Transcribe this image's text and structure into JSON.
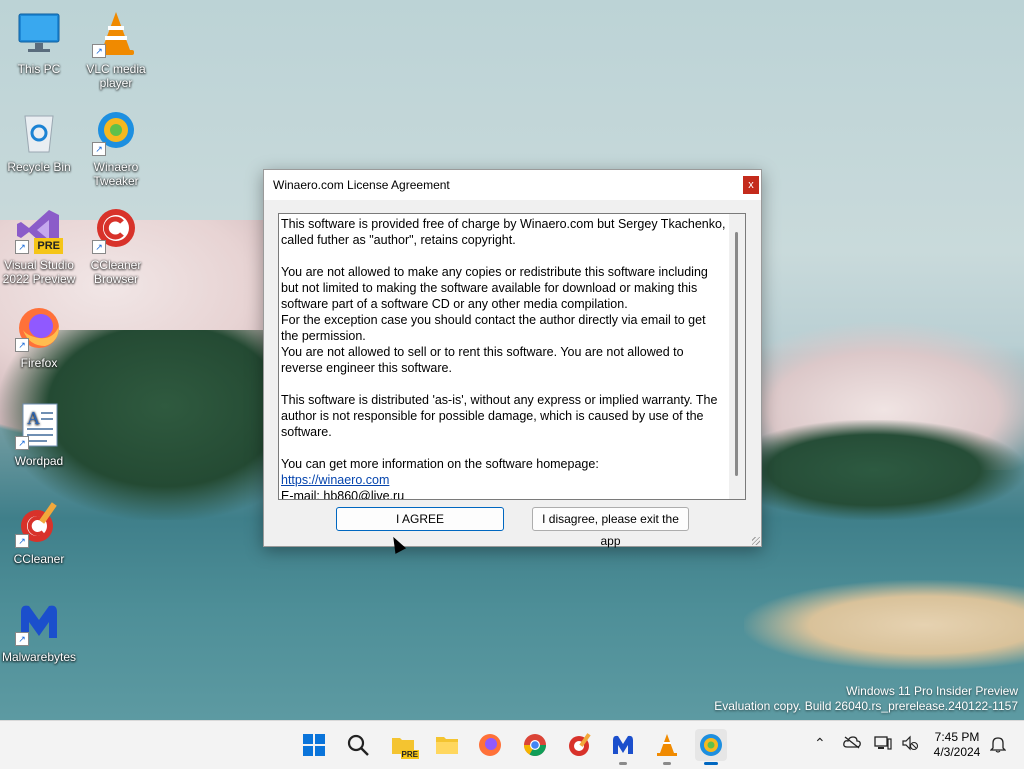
{
  "desktop": {
    "icons": [
      {
        "label": "This PC",
        "icon": "this-pc-icon"
      },
      {
        "label": "VLC media player",
        "icon": "vlc-icon"
      },
      {
        "label": "Recycle Bin",
        "icon": "recycle-bin-icon"
      },
      {
        "label": "Winaero Tweaker",
        "icon": "winaero-tweaker-icon"
      },
      {
        "label": "Visual Studio 2022 Preview",
        "icon": "visual-studio-icon"
      },
      {
        "label": "CCleaner Browser",
        "icon": "ccleaner-browser-icon"
      },
      {
        "label": "Firefox",
        "icon": "firefox-icon"
      },
      {
        "label": "Wordpad",
        "icon": "wordpad-icon"
      },
      {
        "label": "CCleaner",
        "icon": "ccleaner-icon"
      },
      {
        "label": "Malwarebytes",
        "icon": "malwarebytes-icon"
      }
    ],
    "vs_badge": "PRE",
    "watermark": {
      "line1": "Windows 11 Pro Insider Preview",
      "line2": "Evaluation copy. Build 26040.rs_prerelease.240122-1157"
    }
  },
  "dialog": {
    "title": "Winaero.com License Agreement",
    "close_label": "x",
    "text_paragraphs": [
      "This software is provided free of charge by Winaero.com but Sergey Tkachenko, called futher as \"author\", retains copyright.",
      "You are not allowed to make any copies or redistribute this software including but not limited to making the software available for download or making this software part of a software CD or any other media compilation.\nFor the exception case you should contact the author directly via email to get the permission.\nYou are not allowed to sell or to rent this software. You are not allowed to reverse engineer this software.",
      "This software is distributed 'as-is', without any express or implied warranty. The author is not responsible for possible damage, which is caused by use of the software.",
      "You can get more information on the software homepage:"
    ],
    "homepage_link": "https://winaero.com",
    "email_line": "E-mail: hb860@live.ru",
    "agree_button": "I AGREE",
    "disagree_button": "I disagree, please exit the app"
  },
  "taskbar": {
    "pinned": [
      {
        "name": "start-button",
        "icon": "windows-logo-icon"
      },
      {
        "name": "search-button",
        "icon": "search-icon"
      },
      {
        "name": "taskbar-app-file-explorer-canary",
        "icon": "explorer-pre-icon"
      },
      {
        "name": "taskbar-app-file-explorer",
        "icon": "folder-icon"
      },
      {
        "name": "taskbar-app-firefox",
        "icon": "firefox-icon"
      },
      {
        "name": "taskbar-app-chrome",
        "icon": "chrome-icon"
      },
      {
        "name": "taskbar-app-ccleaner",
        "icon": "ccleaner-icon"
      },
      {
        "name": "taskbar-app-malwarebytes",
        "icon": "malwarebytes-icon"
      },
      {
        "name": "taskbar-app-vlc",
        "icon": "vlc-icon"
      },
      {
        "name": "taskbar-app-winaero-tweaker",
        "icon": "winaero-tweaker-icon"
      }
    ],
    "pre_badge": "PRE",
    "clock": {
      "time": "7:45 PM",
      "date": "4/3/2024"
    }
  }
}
